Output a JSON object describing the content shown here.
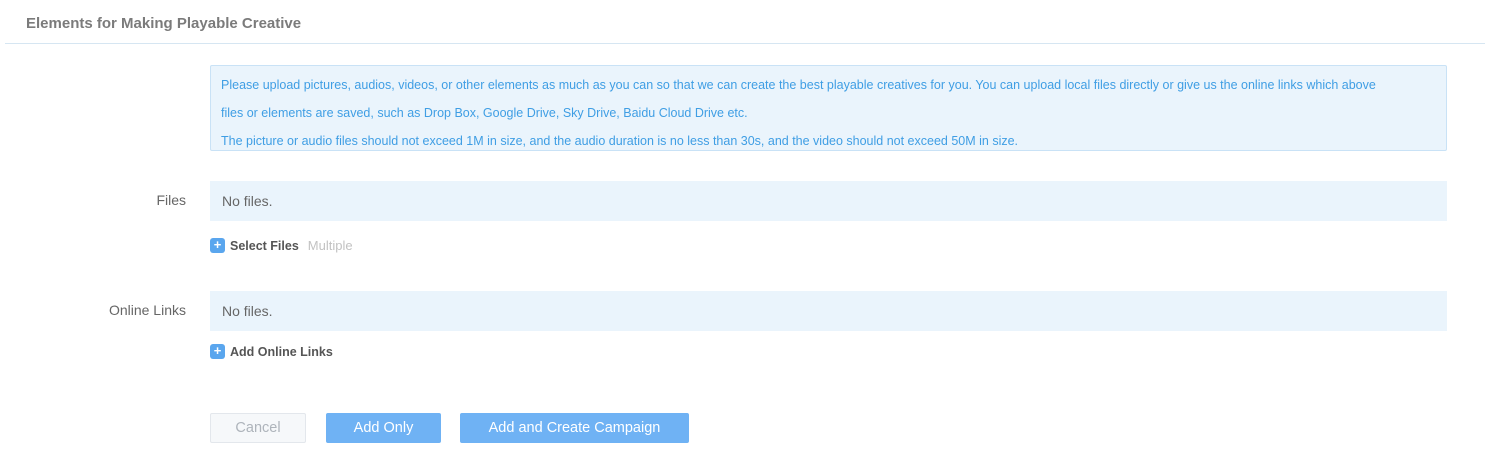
{
  "section": {
    "title": "Elements for Making Playable Creative"
  },
  "notice": {
    "line1": "Please upload pictures, audios, videos, or other elements as much as you can so that we can create the best playable creatives for you. You can upload local files directly or give us the online links which above",
    "line2": "files or elements are saved, such as Drop Box, Google Drive, Sky Drive, Baidu Cloud Drive etc.",
    "line3": "The picture or audio files should not exceed 1M in size, and the audio duration is no less than 30s, and the video should not exceed 50M in size."
  },
  "files": {
    "label": "Files",
    "empty_text": "No files.",
    "select_label": "Select Files",
    "select_hint": "Multiple",
    "icon": "plus-icon"
  },
  "online_links": {
    "label": "Online Links",
    "empty_text": "No files.",
    "add_label": "Add Online Links",
    "icon": "plus-icon"
  },
  "actions": {
    "cancel_label": "Cancel",
    "add_only_label": "Add Only",
    "add_and_create_label": "Add and Create Campaign"
  },
  "colors": {
    "accent": "#6fb2f4",
    "notice_text": "#3f9ee4",
    "notice_bg": "#eaf4fc"
  }
}
